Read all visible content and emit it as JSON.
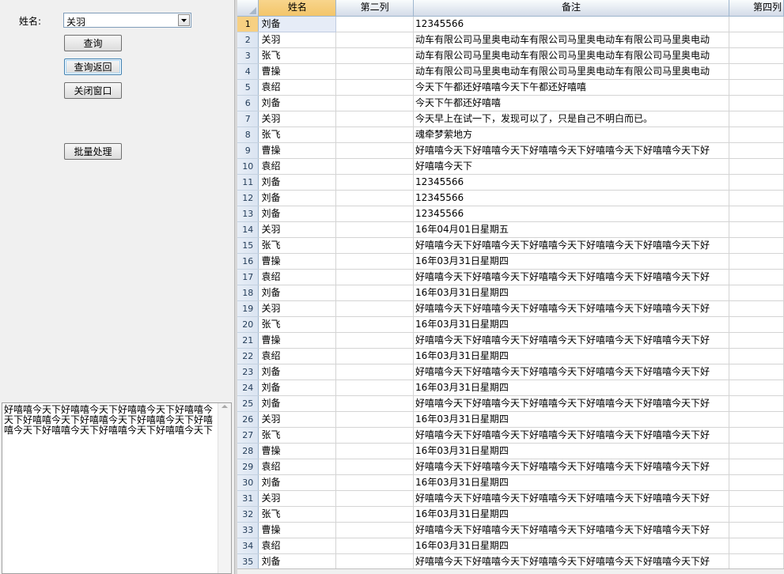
{
  "form": {
    "name_label": "姓名:",
    "name_value": "关羽",
    "buttons": {
      "query": "查询",
      "query_return": "查询返回",
      "close_window": "关闭窗口",
      "batch_process": "批量处理"
    },
    "memo_text": "好嘻嘻今天下好嘻嘻今天下好嘻嘻今天下好嘻嘻今天下好嘻嘻今天下好嘻嘻今天下好嘻嘻今天下好嘻嘻今天下好嘻嘻今天下好嘻嘻今天下好嘻嘻今天下"
  },
  "grid": {
    "columns": [
      "姓名",
      "第二列",
      "备注",
      "第四列"
    ],
    "rows": [
      {
        "no": "1",
        "name": "刘备",
        "col2": "",
        "note": "12345566"
      },
      {
        "no": "2",
        "name": "关羽",
        "col2": "",
        "note": "动车有限公司马里奥电动车有限公司马里奥电动车有限公司马里奥电动"
      },
      {
        "no": "3",
        "name": "张飞",
        "col2": "",
        "note": "动车有限公司马里奥电动车有限公司马里奥电动车有限公司马里奥电动"
      },
      {
        "no": "4",
        "name": "曹操",
        "col2": "",
        "note": "动车有限公司马里奥电动车有限公司马里奥电动车有限公司马里奥电动"
      },
      {
        "no": "5",
        "name": "袁绍",
        "col2": "",
        "note": "今天下午都还好嘻嘻今天下午都还好嘻嘻"
      },
      {
        "no": "6",
        "name": "刘备",
        "col2": "",
        "note": "今天下午都还好嘻嘻"
      },
      {
        "no": "7",
        "name": "关羽",
        "col2": "",
        "note": "今天早上在试一下，发现可以了，只是自己不明白而已。"
      },
      {
        "no": "8",
        "name": "张飞",
        "col2": "",
        "note": "魂牵梦萦地方"
      },
      {
        "no": "9",
        "name": "曹操",
        "col2": "",
        "note": "好嘻嘻今天下好嘻嘻今天下好嘻嘻今天下好嘻嘻今天下好嘻嘻今天下好"
      },
      {
        "no": "10",
        "name": "袁绍",
        "col2": "",
        "note": "好嘻嘻今天下"
      },
      {
        "no": "11",
        "name": "刘备",
        "col2": "",
        "note": "12345566"
      },
      {
        "no": "12",
        "name": "刘备",
        "col2": "",
        "note": "12345566"
      },
      {
        "no": "13",
        "name": "刘备",
        "col2": "",
        "note": "12345566"
      },
      {
        "no": "14",
        "name": "关羽",
        "col2": "",
        "note": "16年04月01日星期五"
      },
      {
        "no": "15",
        "name": "张飞",
        "col2": "",
        "note": "好嘻嘻今天下好嘻嘻今天下好嘻嘻今天下好嘻嘻今天下好嘻嘻今天下好"
      },
      {
        "no": "16",
        "name": "曹操",
        "col2": "",
        "note": "16年03月31日星期四"
      },
      {
        "no": "17",
        "name": "袁绍",
        "col2": "",
        "note": "好嘻嘻今天下好嘻嘻今天下好嘻嘻今天下好嘻嘻今天下好嘻嘻今天下好"
      },
      {
        "no": "18",
        "name": "刘备",
        "col2": "",
        "note": "16年03月31日星期四"
      },
      {
        "no": "19",
        "name": "关羽",
        "col2": "",
        "note": "好嘻嘻今天下好嘻嘻今天下好嘻嘻今天下好嘻嘻今天下好嘻嘻今天下好"
      },
      {
        "no": "20",
        "name": "张飞",
        "col2": "",
        "note": "16年03月31日星期四"
      },
      {
        "no": "21",
        "name": "曹操",
        "col2": "",
        "note": "好嘻嘻今天下好嘻嘻今天下好嘻嘻今天下好嘻嘻今天下好嘻嘻今天下好"
      },
      {
        "no": "22",
        "name": "袁绍",
        "col2": "",
        "note": "16年03月31日星期四"
      },
      {
        "no": "23",
        "name": "刘备",
        "col2": "",
        "note": "好嘻嘻今天下好嘻嘻今天下好嘻嘻今天下好嘻嘻今天下好嘻嘻今天下好"
      },
      {
        "no": "24",
        "name": "刘备",
        "col2": "",
        "note": "16年03月31日星期四"
      },
      {
        "no": "25",
        "name": "刘备",
        "col2": "",
        "note": "好嘻嘻今天下好嘻嘻今天下好嘻嘻今天下好嘻嘻今天下好嘻嘻今天下好"
      },
      {
        "no": "26",
        "name": "关羽",
        "col2": "",
        "note": "16年03月31日星期四"
      },
      {
        "no": "27",
        "name": "张飞",
        "col2": "",
        "note": "好嘻嘻今天下好嘻嘻今天下好嘻嘻今天下好嘻嘻今天下好嘻嘻今天下好"
      },
      {
        "no": "28",
        "name": "曹操",
        "col2": "",
        "note": "16年03月31日星期四"
      },
      {
        "no": "29",
        "name": "袁绍",
        "col2": "",
        "note": "好嘻嘻今天下好嘻嘻今天下好嘻嘻今天下好嘻嘻今天下好嘻嘻今天下好"
      },
      {
        "no": "30",
        "name": "刘备",
        "col2": "",
        "note": "16年03月31日星期四"
      },
      {
        "no": "31",
        "name": "关羽",
        "col2": "",
        "note": "好嘻嘻今天下好嘻嘻今天下好嘻嘻今天下好嘻嘻今天下好嘻嘻今天下好"
      },
      {
        "no": "32",
        "name": "张飞",
        "col2": "",
        "note": "16年03月31日星期四"
      },
      {
        "no": "33",
        "name": "曹操",
        "col2": "",
        "note": "好嘻嘻今天下好嘻嘻今天下好嘻嘻今天下好嘻嘻今天下好嘻嘻今天下好"
      },
      {
        "no": "34",
        "name": "袁绍",
        "col2": "",
        "note": "16年03月31日星期四"
      },
      {
        "no": "35",
        "name": "刘备",
        "col2": "",
        "note": "好嘻嘻今天下好嘻嘻今天下好嘻嘻今天下好嘻嘻今天下好嘻嘻今天下好"
      }
    ]
  },
  "icons": {
    "dropdown": "chevron-down-icon",
    "corner": "select-all-icon",
    "scroll_up": "scroll-up-arrow-icon"
  },
  "colors": {
    "header_selected": "#f3c56a",
    "grid_line": "#d4d4d4",
    "window_bg": "#f0f0f0"
  }
}
